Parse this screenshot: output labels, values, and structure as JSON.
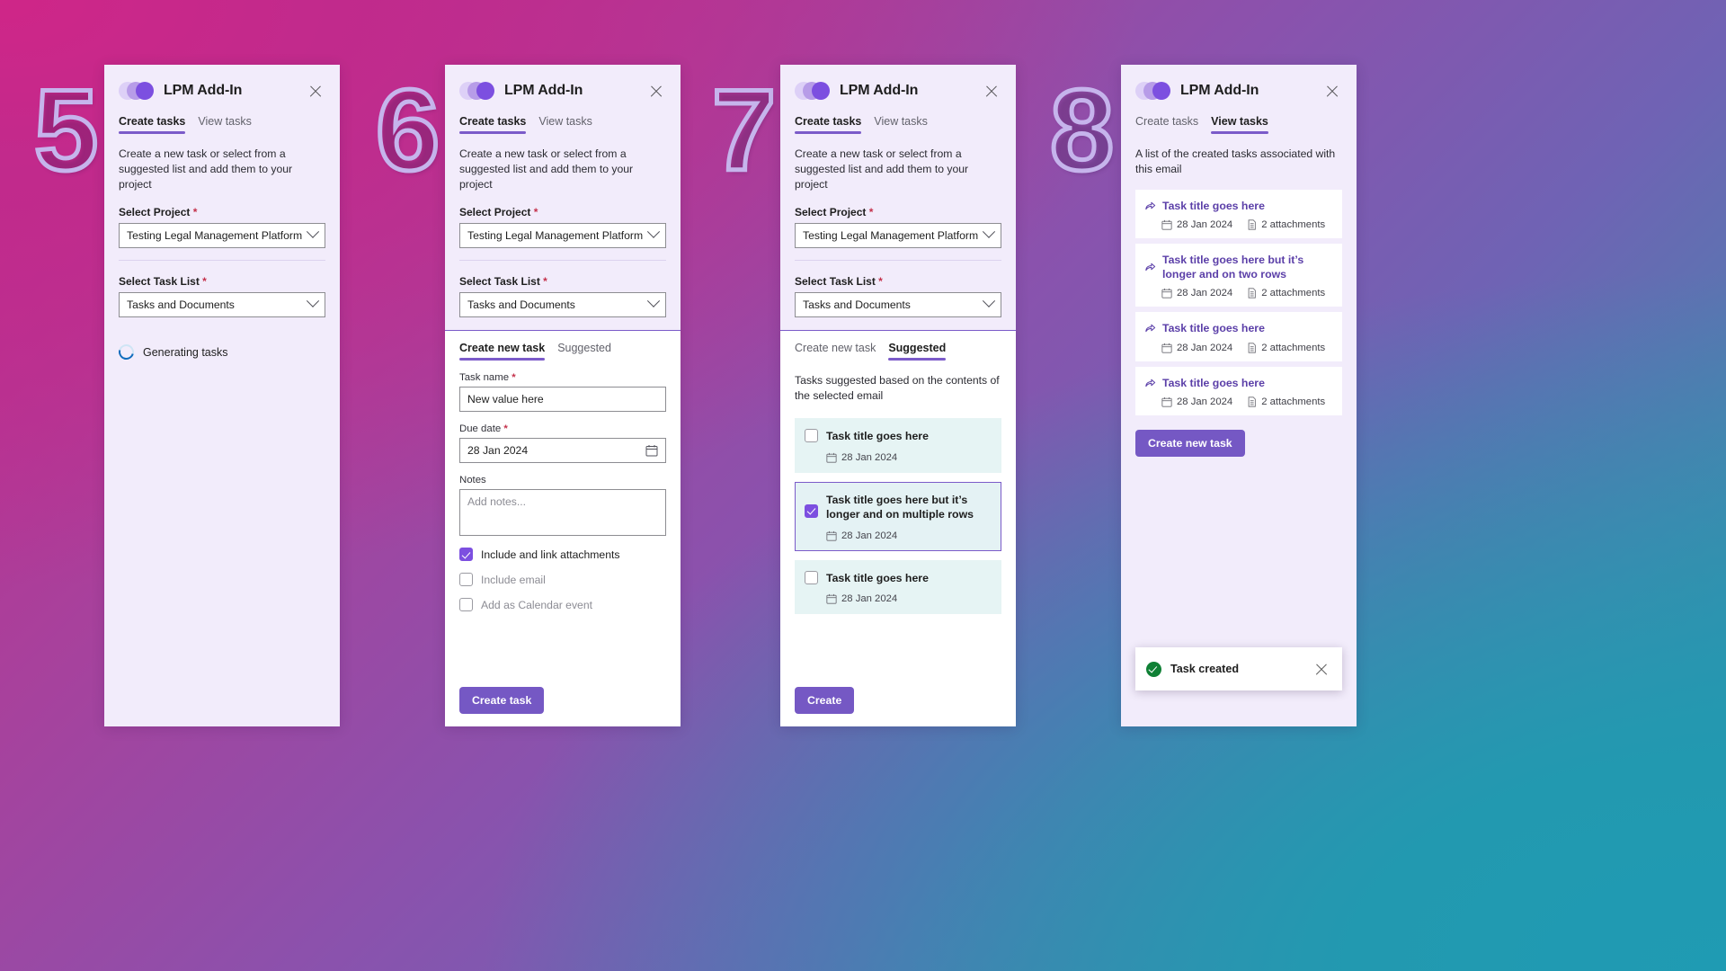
{
  "app": {
    "title": "LPM Add-In",
    "close_icon": "close-icon",
    "logo_icon": "lpm-logo-icon"
  },
  "tabs": {
    "create": "Create tasks",
    "view": "View tasks"
  },
  "copy": {
    "create_intro": "Create a new task or select from a suggested list and add them to your project",
    "view_intro": "A list of the created tasks associated with this email",
    "suggested_intro": "Tasks suggested based on the contents of the selected email"
  },
  "fields": {
    "project_label": "Select Project",
    "project_value": "Testing Legal Management Platform",
    "tasklist_label": "Select Task List",
    "tasklist_value": "Tasks and Documents",
    "required_marker": "*"
  },
  "loading": {
    "text": "Generating tasks",
    "icon": "spinner-icon"
  },
  "subtabs": {
    "create_new_task": "Create new task",
    "suggested": "Suggested"
  },
  "form": {
    "task_name_label": "Task name",
    "task_name_value": "New value here",
    "due_date_label": "Due date",
    "due_date_value": "28 Jan 2024",
    "due_date_icon": "calendar-icon",
    "notes_label": "Notes",
    "notes_placeholder": "Add notes...",
    "checkboxes": [
      {
        "label": "Include and link attachments",
        "checked": true
      },
      {
        "label": "Include email",
        "checked": false
      },
      {
        "label": "Add as Calendar event",
        "checked": false
      }
    ],
    "submit_label": "Create task"
  },
  "suggested": {
    "submit_label": "Create",
    "items": [
      {
        "title": "Task title goes here",
        "date": "28 Jan 2024",
        "checked": false
      },
      {
        "title": "Task title goes here but it’s longer and on multiple rows",
        "date": "28 Jan 2024",
        "checked": true
      },
      {
        "title": "Task title goes here",
        "date": "28 Jan 2024",
        "checked": false
      }
    ]
  },
  "view_tasks": {
    "create_button": "Create new task",
    "items": [
      {
        "title": "Task title goes here",
        "date": "28 Jan 2024",
        "attachments": "2 attachments"
      },
      {
        "title": "Task title goes here but it’s longer and on two rows",
        "date": "28 Jan 2024",
        "attachments": "2 attachments"
      },
      {
        "title": "Task title goes here",
        "date": "28 Jan 2024",
        "attachments": "2 attachments"
      },
      {
        "title": "Task title goes here",
        "date": "28 Jan 2024",
        "attachments": "2 attachments"
      }
    ]
  },
  "toast": {
    "message": "Task created",
    "icon": "success-check-icon",
    "close_icon": "close-icon"
  },
  "steps": {
    "s5": "5",
    "s6": "6",
    "s7": "7",
    "s8": "8"
  },
  "colors": {
    "accent_purple": "#7558c4",
    "tab_underline": "#7b5bc9",
    "panel_bg": "#f2ecfb",
    "suggested_card": "#e6f4f4",
    "task_title": "#5b3fa8",
    "required_red": "#c4314b",
    "success_green": "#0f8035",
    "spinner_blue": "#0f6cbd",
    "step_numeral": "#c6b4ec"
  }
}
